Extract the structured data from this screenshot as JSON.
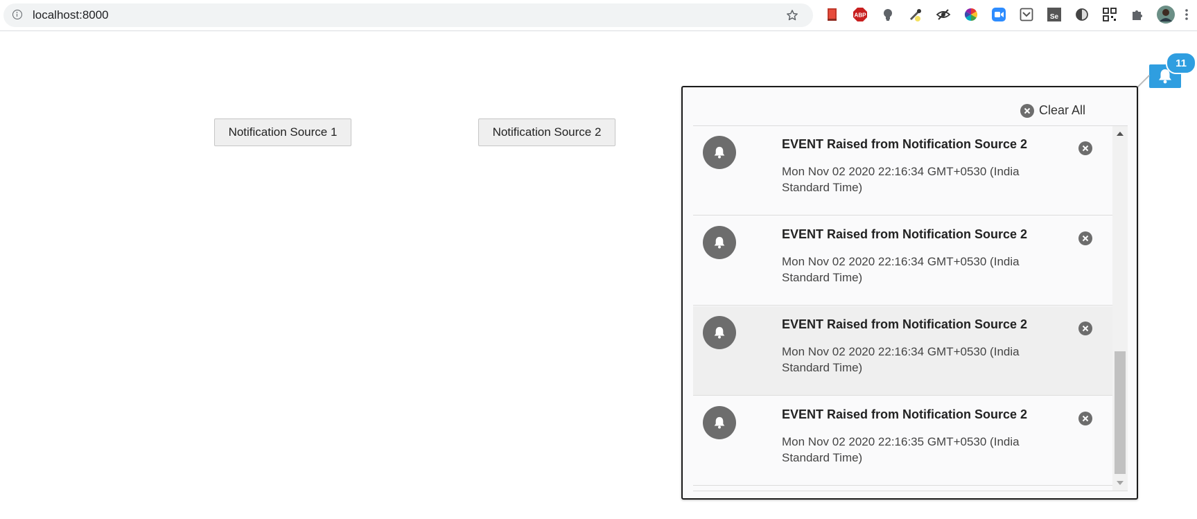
{
  "browser": {
    "url": "localhost:8000",
    "extensions": [
      "bookmark-icon",
      "adblock-icon",
      "lightbulb-icon",
      "eyedropper-icon",
      "eye-slash-icon",
      "color-wheel-icon",
      "zoom-icon",
      "pocket-icon",
      "selenium-icon",
      "half-circle-icon",
      "qr-code-icon",
      "puzzle-icon",
      "profile-avatar"
    ],
    "adblock_label": "ABP",
    "selenium_label": "Se"
  },
  "page": {
    "source_buttons": [
      {
        "label": "Notification Source 1"
      },
      {
        "label": "Notification Source 2"
      }
    ]
  },
  "bell": {
    "count": "11",
    "color": "#2f9ee0"
  },
  "panel": {
    "clear_all_label": "Clear All",
    "items": [
      {
        "title": "EVENT Raised from Notification Source 2",
        "time": "Mon Nov 02 2020 22:16:34 GMT+0530 (India Standard Time)",
        "highlighted": false
      },
      {
        "title": "EVENT Raised from Notification Source 2",
        "time": "Mon Nov 02 2020 22:16:34 GMT+0530 (India Standard Time)",
        "highlighted": false
      },
      {
        "title": "EVENT Raised from Notification Source 2",
        "time": "Mon Nov 02 2020 22:16:34 GMT+0530 (India Standard Time)",
        "highlighted": true
      },
      {
        "title": "EVENT Raised from Notification Source 2",
        "time": "Mon Nov 02 2020 22:16:35 GMT+0530 (India Standard Time)",
        "highlighted": false
      }
    ]
  }
}
